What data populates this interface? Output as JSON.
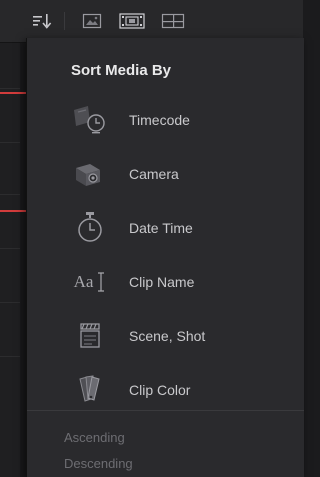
{
  "toolbar": {
    "sort_icon": "sort-order-icon",
    "view_icons": [
      "thumbnail-view-icon",
      "filmstrip-view-icon",
      "list-view-icon"
    ]
  },
  "menu": {
    "title": "Sort Media By",
    "items": [
      {
        "label": "Timecode",
        "icon": "timecode-icon"
      },
      {
        "label": "Camera",
        "icon": "camera-icon"
      },
      {
        "label": "Date Time",
        "icon": "stopwatch-icon"
      },
      {
        "label": "Clip Name",
        "icon": "text-cursor-icon",
        "icon_text": "Aa"
      },
      {
        "label": "Scene, Shot",
        "icon": "clapperboard-icon"
      },
      {
        "label": "Clip Color",
        "icon": "color-swatches-icon"
      }
    ],
    "order": {
      "ascending": "Ascending",
      "descending": "Descending"
    }
  },
  "colors": {
    "panel_bg": "#2a2a2d",
    "toolbar_bg": "#28282a",
    "label": "#c9c9cc",
    "title": "#e9e9ea",
    "disabled": "#6d6d72",
    "marker_red": "#d23c3c"
  }
}
